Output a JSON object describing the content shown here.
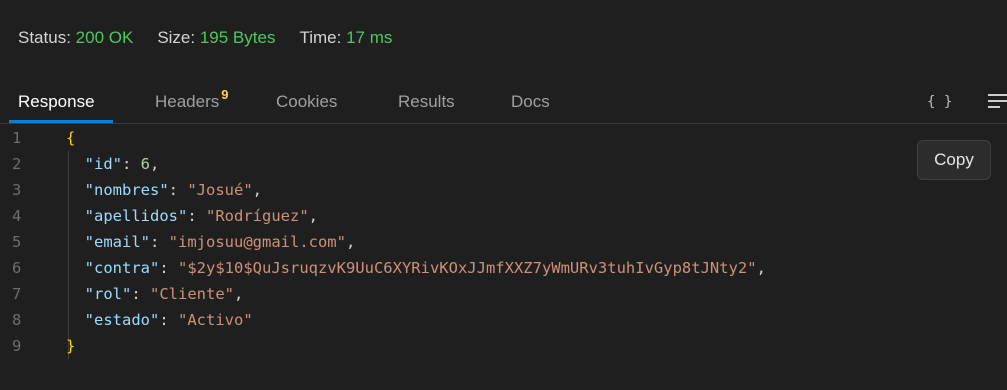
{
  "status": {
    "status_label": "Status:",
    "status_value": "200 OK",
    "size_label": "Size:",
    "size_value": "195 Bytes",
    "time_label": "Time:",
    "time_value": "17 ms",
    "value_color": "#4ec95b"
  },
  "tabs": {
    "response": "Response",
    "headers": "Headers",
    "headers_count": "9",
    "cookies": "Cookies",
    "results": "Results",
    "docs": "Docs",
    "active": "Response"
  },
  "toolbar": {
    "format_icon": "braces-icon",
    "format_glyph": "{ }",
    "menu_icon": "menu-icon",
    "copy_label": "Copy"
  },
  "code": {
    "lines": [
      {
        "num": "1",
        "open": "{"
      },
      {
        "num": "2",
        "key": "\"id\"",
        "value": "6",
        "value_type": "number",
        "comma": ","
      },
      {
        "num": "3",
        "key": "\"nombres\"",
        "value": "\"Josué\"",
        "value_type": "string",
        "comma": ","
      },
      {
        "num": "4",
        "key": "\"apellidos\"",
        "value": "\"Rodríguez\"",
        "value_type": "string",
        "comma": ","
      },
      {
        "num": "5",
        "key": "\"email\"",
        "value": "\"imjosuu@gmail.com\"",
        "value_type": "string",
        "comma": ","
      },
      {
        "num": "6",
        "key": "\"contra\"",
        "value": "\"$2y$10$QuJsruqzvK9UuC6XYRivKOxJJmfXXZ7yWmURv3tuhIvGyp8tJNty2\"",
        "value_type": "string",
        "comma": ","
      },
      {
        "num": "7",
        "key": "\"rol\"",
        "value": "\"Cliente\"",
        "value_type": "string",
        "comma": ","
      },
      {
        "num": "8",
        "key": "\"estado\"",
        "value": "\"Activo\"",
        "value_type": "string",
        "comma": ""
      },
      {
        "num": "9",
        "close": "}"
      }
    ]
  }
}
